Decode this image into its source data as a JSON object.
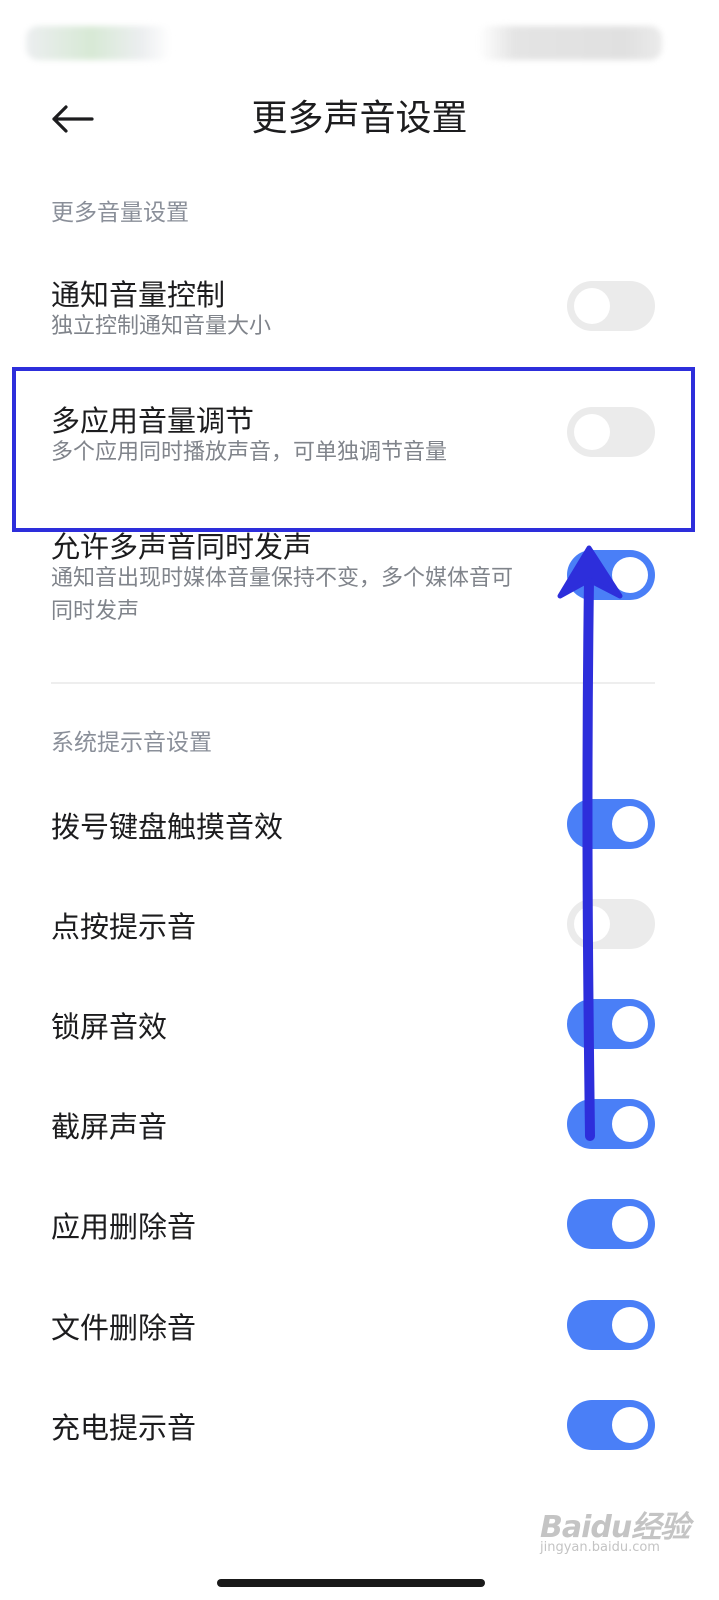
{
  "header": {
    "title": "更多声音设置",
    "back_icon": "arrow-left-icon"
  },
  "sections": [
    {
      "header": "更多音量设置",
      "items": [
        {
          "title": "通知音量控制",
          "subtitle": "独立控制通知音量大小",
          "enabled": false
        },
        {
          "title": "多应用音量调节",
          "subtitle": "多个应用同时播放声音，可单独调节音量",
          "enabled": false
        },
        {
          "title": "允许多声音同时发声",
          "subtitle": "通知音出现时媒体音量保持不变，多个媒体音可同时发声",
          "enabled": true
        }
      ]
    },
    {
      "header": "系统提示音设置",
      "items": [
        {
          "title": "拨号键盘触摸音效",
          "enabled": true
        },
        {
          "title": "点按提示音",
          "enabled": false
        },
        {
          "title": "锁屏音效",
          "enabled": true
        },
        {
          "title": "截屏声音",
          "enabled": true
        },
        {
          "title": "应用删除音",
          "enabled": true
        },
        {
          "title": "文件删除音",
          "enabled": true
        },
        {
          "title": "充电提示音",
          "enabled": true
        }
      ]
    }
  ],
  "annotation": {
    "highlight_color": "#2d2edb",
    "arrow_color": "#2d2edb"
  },
  "colors": {
    "toggle_on": "#4a7ff7",
    "toggle_off": "#ebebeb"
  },
  "watermark": {
    "logo": "Baidu经验",
    "url": "jingyan.baidu.com"
  }
}
